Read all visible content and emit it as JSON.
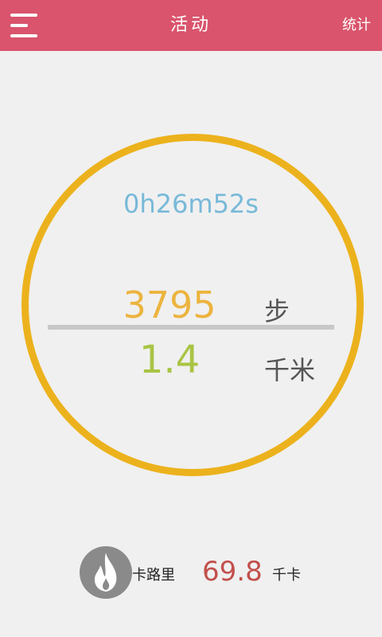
{
  "header": {
    "title": "活动",
    "stats_label": "统计",
    "background_color": "#d9546c",
    "menu_icon": "hamburger-menu-icon"
  },
  "activity": {
    "elapsed_time": "0h26m52s",
    "steps": "3795",
    "steps_unit": "步",
    "distance": "1.4",
    "distance_unit": "千米",
    "ring_color": "#ecb21d",
    "steps_color": "#ecb43f",
    "distance_color": "#a9c444",
    "time_color": "#78b9d9"
  },
  "calories": {
    "icon": "flame-icon",
    "label": "卡路里",
    "value": "69.8",
    "unit": "千卡",
    "value_color": "#c2504c"
  }
}
